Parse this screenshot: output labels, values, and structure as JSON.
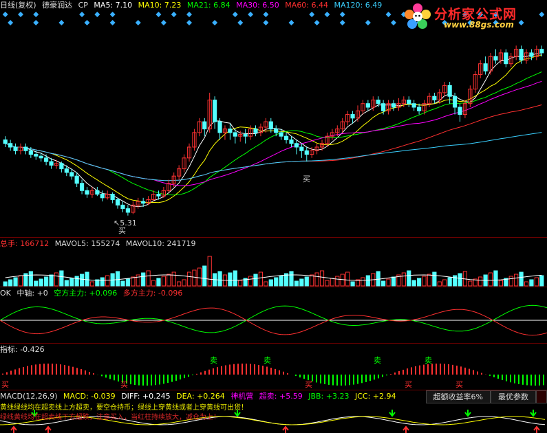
{
  "main_header": {
    "period": "日线(复权)",
    "stock": "德豪润达",
    "cp": "CP",
    "ma5": "MA5: 7.10",
    "ma10": "MA10: 7.23",
    "ma21": "MA21: 6.84",
    "ma30": "MA30: 6.50",
    "ma60": "MA60: 6.44",
    "ma120": "MA120: 6.49"
  },
  "logo": {
    "title": "分析家公式网",
    "url": "www.88gs.com"
  },
  "price_annotations": {
    "low_label": "5.31",
    "buy_1": "买",
    "buy_2": "买"
  },
  "volume_header": {
    "hand": "总手: 166712",
    "mavol5": "MAVOL5: 155274",
    "mavol10": "MAVOL10: 241719"
  },
  "ok_header": {
    "title": "OK",
    "mid": "中轴: +0",
    "short": "空方主力: +0.096",
    "long": "多方主力: -0.096"
  },
  "index_header": {
    "title": "指标: -0.426"
  },
  "sell_label": "卖",
  "buy_label": "买",
  "macd_header": {
    "name": "MACD(12,26,9)",
    "macd": "MACD: -0.039",
    "diff": "DIFF: +0.245",
    "dea": "DEA: +0.264",
    "shenji": "神机营",
    "chaomai": "超卖: +5.59",
    "jbb": "JBB: +3.23",
    "jcc": "JCC: +2.94"
  },
  "bottom_text": {
    "line1": "黄线绿线均在超卖线上方超卖，要空仓持币；绿线上穿黄线或者上穿黄线可出货！",
    "line2": "绿线黄线均在超卖线下方超跌，注意买入，当红柱持续放大，减仓为上！"
  },
  "tabs": {
    "excess": "超额收益率6%",
    "best": "最优参数"
  },
  "colors": {
    "up": "#ff3232",
    "down": "#54ffff",
    "ma5": "#ffffff",
    "ma10": "#ffff00",
    "ma21": "#00ff00",
    "ma30": "#ff00ff",
    "ma60": "#ff3030",
    "ma120": "#3ad0ff"
  },
  "chart_data": {
    "type": "candlestick",
    "candles": [
      [
        7.4,
        7.3,
        7.5,
        7.2
      ],
      [
        7.3,
        7.2,
        7.4,
        7.1
      ],
      [
        7.2,
        7.1,
        7.3,
        7.0
      ],
      [
        7.1,
        7.2,
        7.3,
        7.0
      ],
      [
        7.2,
        7.1,
        7.3,
        7.0
      ],
      [
        7.1,
        7.0,
        7.2,
        6.9
      ],
      [
        7.0,
        6.95,
        7.1,
        6.85
      ],
      [
        6.95,
        6.9,
        7.05,
        6.8
      ],
      [
        6.9,
        6.8,
        7.0,
        6.7
      ],
      [
        6.8,
        6.7,
        6.9,
        6.6
      ],
      [
        6.7,
        6.75,
        6.85,
        6.6
      ],
      [
        6.75,
        6.6,
        6.8,
        6.5
      ],
      [
        6.6,
        6.5,
        6.7,
        6.4
      ],
      [
        6.5,
        6.4,
        6.6,
        6.3
      ],
      [
        6.4,
        6.2,
        6.5,
        6.1
      ],
      [
        6.2,
        6.0,
        6.3,
        5.9
      ],
      [
        6.0,
        5.9,
        6.1,
        5.8
      ],
      [
        5.9,
        6.0,
        6.1,
        5.8
      ],
      [
        6.0,
        5.9,
        6.1,
        5.85
      ],
      [
        5.9,
        5.8,
        6.0,
        5.7
      ],
      [
        5.8,
        5.9,
        6.0,
        5.75
      ],
      [
        5.9,
        5.75,
        5.95,
        5.65
      ],
      [
        5.75,
        5.6,
        5.8,
        5.5
      ],
      [
        5.6,
        5.5,
        5.7,
        5.4
      ],
      [
        5.5,
        5.4,
        5.6,
        5.31
      ],
      [
        5.4,
        5.6,
        5.7,
        5.35
      ],
      [
        5.6,
        5.7,
        5.8,
        5.5
      ],
      [
        5.7,
        5.65,
        5.8,
        5.55
      ],
      [
        5.65,
        5.75,
        5.85,
        5.6
      ],
      [
        5.75,
        5.9,
        6.0,
        5.7
      ],
      [
        5.9,
        5.85,
        6.0,
        5.75
      ],
      [
        5.85,
        6.0,
        6.1,
        5.8
      ],
      [
        6.0,
        6.2,
        6.3,
        5.95
      ],
      [
        6.2,
        6.4,
        6.5,
        6.1
      ],
      [
        6.4,
        6.6,
        6.7,
        6.3
      ],
      [
        6.6,
        6.9,
        7.0,
        6.5
      ],
      [
        6.9,
        7.2,
        7.3,
        6.8
      ],
      [
        7.2,
        7.6,
        7.7,
        7.1
      ],
      [
        7.6,
        7.9,
        8.0,
        7.5
      ],
      [
        7.9,
        7.7,
        8.0,
        7.5
      ],
      [
        7.7,
        8.5,
        8.7,
        7.6
      ],
      [
        8.5,
        7.9,
        8.6,
        7.7
      ],
      [
        7.9,
        7.6,
        8.0,
        7.4
      ],
      [
        7.6,
        7.7,
        7.8,
        7.4
      ],
      [
        7.7,
        7.6,
        7.85,
        7.4
      ],
      [
        7.6,
        7.5,
        7.7,
        7.3
      ],
      [
        7.5,
        7.55,
        7.65,
        7.35
      ],
      [
        7.55,
        7.5,
        7.7,
        7.3
      ],
      [
        7.5,
        7.7,
        7.8,
        7.4
      ],
      [
        7.7,
        7.6,
        7.8,
        7.5
      ],
      [
        7.6,
        7.75,
        7.85,
        7.5
      ],
      [
        7.75,
        7.9,
        8.0,
        7.6
      ],
      [
        7.9,
        7.7,
        8.0,
        7.6
      ],
      [
        7.7,
        7.6,
        7.8,
        7.5
      ],
      [
        7.6,
        7.5,
        7.7,
        7.4
      ],
      [
        7.5,
        7.4,
        7.6,
        7.3
      ],
      [
        7.4,
        7.3,
        7.5,
        7.2
      ],
      [
        7.3,
        7.2,
        7.4,
        7.0
      ],
      [
        7.2,
        7.1,
        7.3,
        6.9
      ],
      [
        7.1,
        7.0,
        7.2,
        6.8
      ],
      [
        7.0,
        7.1,
        7.2,
        6.9
      ],
      [
        7.1,
        7.2,
        7.3,
        7.0
      ],
      [
        7.2,
        7.3,
        7.4,
        7.1
      ],
      [
        7.3,
        7.5,
        7.6,
        7.2
      ],
      [
        7.5,
        7.6,
        7.7,
        7.4
      ],
      [
        7.6,
        7.7,
        7.8,
        7.5
      ],
      [
        7.7,
        7.9,
        8.0,
        7.6
      ],
      [
        7.9,
        8.1,
        8.2,
        7.8
      ],
      [
        8.1,
        8.0,
        8.2,
        7.85
      ],
      [
        8.0,
        8.2,
        8.35,
        7.9
      ],
      [
        8.2,
        8.4,
        8.5,
        8.1
      ],
      [
        8.4,
        8.3,
        8.5,
        8.2
      ],
      [
        8.3,
        8.5,
        8.6,
        8.2
      ],
      [
        8.5,
        8.4,
        8.6,
        8.3
      ],
      [
        8.4,
        8.2,
        8.5,
        8.1
      ],
      [
        8.2,
        8.4,
        8.5,
        8.1
      ],
      [
        8.4,
        8.3,
        8.5,
        8.2
      ],
      [
        8.3,
        8.4,
        8.55,
        8.2
      ],
      [
        8.4,
        8.5,
        8.6,
        8.3
      ],
      [
        8.5,
        8.4,
        8.6,
        8.3
      ],
      [
        8.4,
        8.3,
        8.5,
        8.2
      ],
      [
        8.3,
        8.2,
        8.4,
        8.1
      ],
      [
        8.2,
        8.4,
        8.5,
        8.1
      ],
      [
        8.4,
        8.6,
        8.7,
        8.3
      ],
      [
        8.6,
        8.5,
        8.7,
        8.4
      ],
      [
        8.5,
        8.7,
        8.8,
        8.4
      ],
      [
        8.7,
        8.9,
        9.0,
        8.6
      ],
      [
        8.9,
        8.6,
        9.0,
        8.4
      ],
      [
        8.6,
        8.3,
        8.7,
        8.1
      ],
      [
        8.3,
        8.1,
        8.4,
        7.9
      ],
      [
        8.1,
        8.4,
        8.5,
        8.0
      ],
      [
        8.4,
        8.8,
        8.9,
        8.3
      ],
      [
        8.8,
        9.2,
        9.3,
        8.7
      ],
      [
        9.2,
        9.5,
        9.6,
        9.1
      ],
      [
        9.5,
        9.3,
        9.7,
        9.2
      ],
      [
        9.3,
        9.7,
        9.8,
        9.2
      ],
      [
        9.7,
        9.6,
        9.9,
        9.5
      ],
      [
        9.6,
        9.8,
        9.9,
        9.5
      ],
      [
        9.8,
        9.5,
        9.9,
        9.4
      ],
      [
        9.5,
        9.7,
        9.8,
        9.4
      ],
      [
        9.7,
        9.9,
        10.0,
        9.6
      ],
      [
        9.9,
        9.6,
        10.0,
        9.5
      ],
      [
        9.6,
        9.8,
        9.9,
        9.5
      ],
      [
        9.8,
        9.7,
        9.9,
        9.6
      ],
      [
        9.7,
        9.9,
        10.0,
        9.6
      ],
      [
        9.9,
        9.8,
        10.0,
        9.7
      ]
    ],
    "ylim": [
      5.0,
      10.5
    ],
    "low_mark": 5.31
  }
}
